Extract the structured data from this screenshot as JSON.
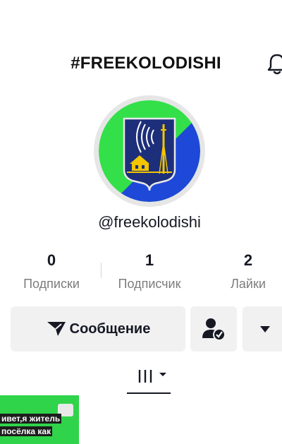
{
  "header": {
    "title": "#FREEKOLODISHI",
    "bell_icon": "bell-icon"
  },
  "profile": {
    "handle": "@freekolodishi",
    "avatar_colors": {
      "green": "#33e04a",
      "blue": "#1e48d8",
      "shield": "#1d2f7a",
      "accent": "#f2c500"
    }
  },
  "stats": [
    {
      "value": "0",
      "label": "Подписки"
    },
    {
      "value": "1",
      "label": "Подписчик"
    },
    {
      "value": "2",
      "label": "Лайки"
    }
  ],
  "actions": {
    "message_label": "Сообщение",
    "message_icon": "send-icon",
    "follow_icon": "user-check-icon",
    "more_icon": "chevron-down-icon"
  },
  "tabs": {
    "grid_icon": "grid-icon"
  },
  "videos": [
    {
      "caption_line1": "ивет,я житель",
      "caption_line2": "посёлка как"
    }
  ]
}
